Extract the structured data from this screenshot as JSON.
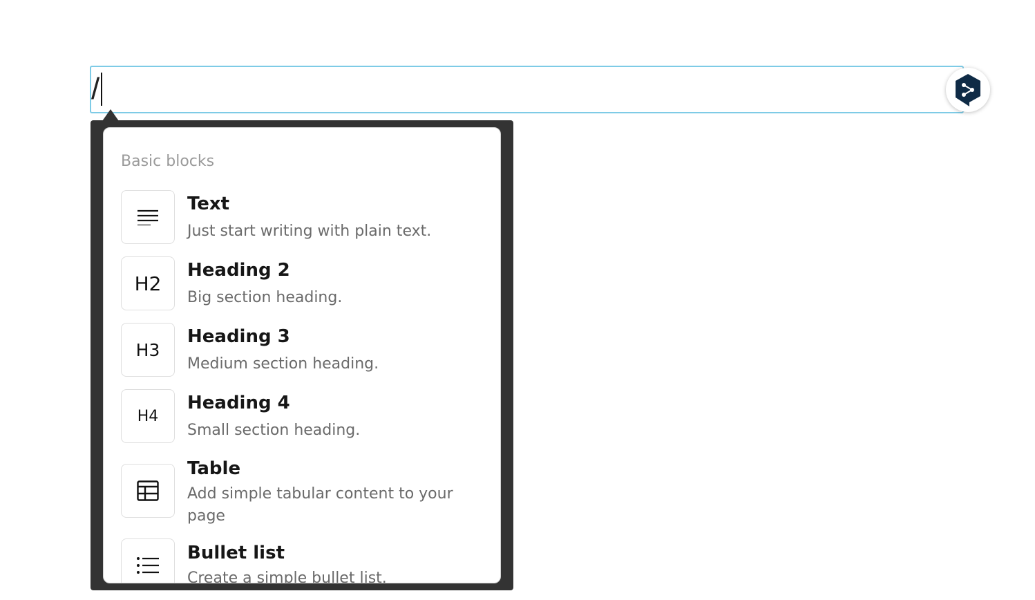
{
  "editor": {
    "value": "/"
  },
  "slash_menu": {
    "section_title": "Basic blocks",
    "items": [
      {
        "icon": "paragraph-icon",
        "icon_text": "",
        "title": "Text",
        "description": "Just start writing with plain text."
      },
      {
        "icon": "heading-2-icon",
        "icon_text": "H2",
        "title": "Heading 2",
        "description": "Big section heading."
      },
      {
        "icon": "heading-3-icon",
        "icon_text": "H3",
        "title": "Heading 3",
        "description": "Medium section heading."
      },
      {
        "icon": "heading-4-icon",
        "icon_text": "H4",
        "title": "Heading 4",
        "description": "Small section heading."
      },
      {
        "icon": "table-icon",
        "icon_text": "",
        "title": "Table",
        "description": "Add simple tabular content to your page"
      },
      {
        "icon": "bullet-list-icon",
        "icon_text": "",
        "title": "Bullet list",
        "description": "Create a simple bullet list."
      }
    ]
  },
  "colors": {
    "focus_border": "#7ecbe6",
    "popup_frame": "#333333",
    "deepl_brand": "#0f2b46"
  },
  "deepl": {
    "icon": "deepl-logo-icon"
  }
}
